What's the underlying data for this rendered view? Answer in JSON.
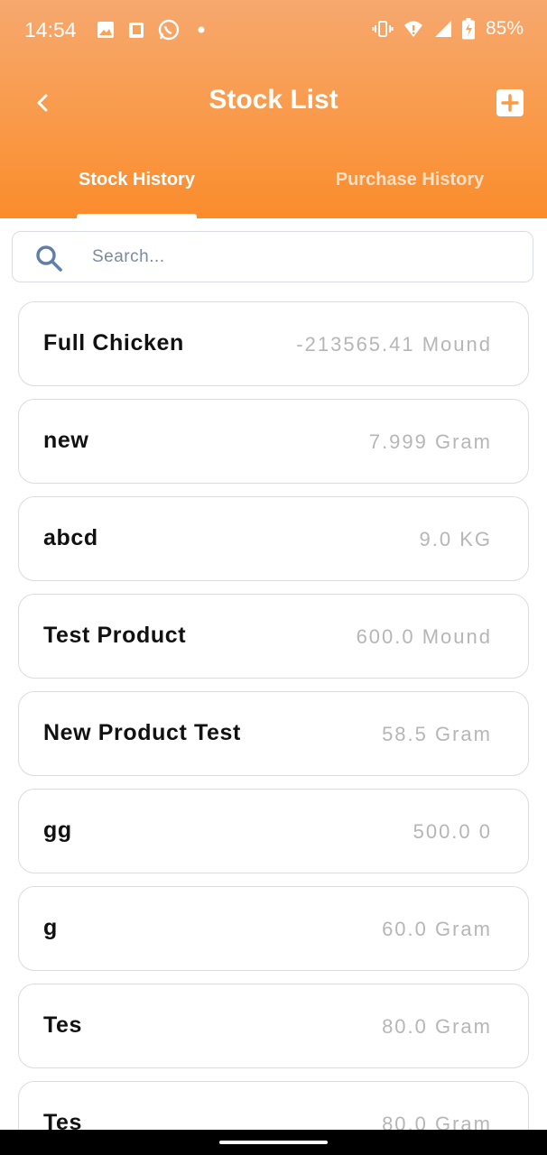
{
  "status_bar": {
    "time": "14:54",
    "battery": "85%",
    "left_icons": [
      "image-icon",
      "clipboard-icon",
      "whatsapp-icon",
      "dot-icon"
    ],
    "right_icons": [
      "vibrate-icon",
      "wifi-icon",
      "signal-icon",
      "battery-icon"
    ]
  },
  "header": {
    "title": "Stock List",
    "back_icon": "chevron-left-icon",
    "add_icon": "plus-square-icon"
  },
  "tabs": [
    {
      "label": "Stock History",
      "active": true
    },
    {
      "label": "Purchase History",
      "active": false
    }
  ],
  "search": {
    "placeholder": "Search...",
    "value": ""
  },
  "stock_items": [
    {
      "name": "Full Chicken",
      "quantity": "-213565.41 Mound"
    },
    {
      "name": "new",
      "quantity": "7.999 Gram"
    },
    {
      "name": "abcd",
      "quantity": "9.0 KG"
    },
    {
      "name": "Test Product",
      "quantity": "600.0 Mound"
    },
    {
      "name": "New Product Test",
      "quantity": "58.5 Gram"
    },
    {
      "name": "gg",
      "quantity": "500.0 0"
    },
    {
      "name": "g",
      "quantity": "60.0 Gram"
    },
    {
      "name": "Tes",
      "quantity": "80.0 Gram"
    },
    {
      "name": "Tes",
      "quantity": "80.0 Gram"
    }
  ],
  "colors": {
    "header_top": "#f6a86e",
    "header_bottom": "#fb8c2c",
    "card_border": "#dcdcdc",
    "quantity_text": "#b6b6b6"
  }
}
